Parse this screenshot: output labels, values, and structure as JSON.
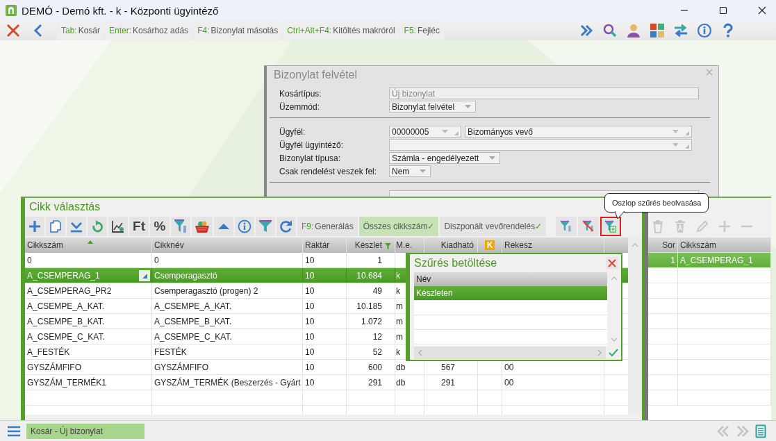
{
  "window": {
    "title": "DEMÓ - Demó kft. - k - Központi ügyintéző"
  },
  "toolbar": {
    "shortcuts": [
      {
        "key": "Tab:",
        "label": "Kosár"
      },
      {
        "key": "Enter:",
        "label": "Kosárhoz adás"
      },
      {
        "key": "F4:",
        "label": "Bizonylat másolás"
      },
      {
        "key": "Ctrl+Alt+F4:",
        "label": "Kitöltés makróról"
      },
      {
        "key": "F5:",
        "label": "Fejléc"
      }
    ]
  },
  "document_dialog": {
    "title": "Bizonylat felvétel",
    "groups": [
      [
        {
          "label": "Kosártípus:",
          "kind": "readonly",
          "value": "Új bizonylat"
        },
        {
          "label": "Üzemmód:",
          "kind": "select",
          "value": "Bizonylat felvétel"
        }
      ],
      [
        {
          "label": "Ügyfél:",
          "kind": "pair",
          "values": [
            "00000005",
            "Bizományos vevő"
          ]
        },
        {
          "label": "Ügyfél ügyintéző:",
          "kind": "combo"
        },
        {
          "label": "Bizonylat típusa:",
          "kind": "select",
          "value": "Számla - engedélyezett"
        },
        {
          "label": "Csak rendelést veszek fel:",
          "kind": "select",
          "value": "Nem"
        }
      ]
    ]
  },
  "article_panel": {
    "title": "Cikk választás",
    "tool_labels": [
      "Ft",
      "%"
    ],
    "commands": [
      {
        "key": "F9:",
        "label": "Generálás"
      }
    ],
    "toggles": [
      {
        "label": "Összes cikkszám",
        "mark": "✓",
        "selected": true
      },
      {
        "label": "Diszponált vevőrendelés",
        "mark": "✓",
        "selected": false
      }
    ],
    "filter_buttons": [
      {
        "highlighted": false
      },
      {
        "highlighted": false
      },
      {
        "highlighted": true
      }
    ],
    "grid": {
      "columns": [
        {
          "label": "Cikkszám",
          "sorted": true
        },
        {
          "label": "Cikknév"
        },
        {
          "label": "Raktár"
        },
        {
          "label": "Készlet",
          "filtered": true
        },
        {
          "label": "M.e."
        },
        {
          "label": "Kiadható"
        },
        {
          "label": "K",
          "kind": "badge"
        },
        {
          "label": "Rekesz"
        }
      ],
      "rows": [
        {
          "selected": false,
          "article_no": "0",
          "name": "0",
          "warehouse": "10",
          "stock": "1"
        },
        {
          "selected": true,
          "article_no": "A_CSEMPERAG_1",
          "name": "Csemperagasztó",
          "warehouse": "10",
          "stock": "10.684",
          "unit": "k"
        },
        {
          "selected": false,
          "article_no": "A_CSEMPERAG_PR2",
          "name": "Csemperagasztó (progen) 2",
          "warehouse": "10",
          "stock": "49",
          "unit": "k"
        },
        {
          "selected": false,
          "article_no": "A_CSEMPE_A_KAT.",
          "name": "A_CSEMPE_A_KAT.",
          "warehouse": "10",
          "stock": "10.185",
          "unit": "m"
        },
        {
          "selected": false,
          "article_no": "A_CSEMPE_B_KAT.",
          "name": "A_CSEMPE_B_KAT.",
          "warehouse": "10",
          "stock": "1.072",
          "unit": "m"
        },
        {
          "selected": false,
          "article_no": "A_CSEMPE_C_KAT.",
          "name": "A_CSEMPE_C_KAT.",
          "warehouse": "10",
          "stock": "12",
          "unit": "m"
        },
        {
          "selected": false,
          "article_no": "A_FESTÉK",
          "name": "FESTÉK",
          "warehouse": "10",
          "stock": "52",
          "unit": "k"
        },
        {
          "selected": false,
          "article_no": "GYSZÁMFIFO",
          "name": "GYSZÁMFIFO",
          "warehouse": "10",
          "stock": "600",
          "unit": "db",
          "available": "567",
          "bin": "00"
        },
        {
          "selected": false,
          "article_no": "GYSZÁM_TERMÉK1",
          "name": "GYSZÁM_TERMÉK (Beszerzés - Gyárt",
          "warehouse": "10",
          "stock": "291",
          "unit": "db",
          "available": "291",
          "bin": "00"
        }
      ]
    }
  },
  "basket_grid": {
    "columns": [
      "Sor",
      "Cikkszám"
    ],
    "rows": [
      {
        "row": "1",
        "article_no": "A_CSEMPERAG_1",
        "selected": true
      }
    ]
  },
  "filter_popup": {
    "title": "Szűrés betöltése",
    "column": "Név",
    "rows": [
      {
        "name": "Készleten",
        "selected": true
      }
    ]
  },
  "tooltip": {
    "text": "Oszlop szűrés beolvasása"
  },
  "status_bar": {
    "tabs": [
      {
        "label": "Kosár - Új bizonylat",
        "selected": true
      }
    ]
  }
}
